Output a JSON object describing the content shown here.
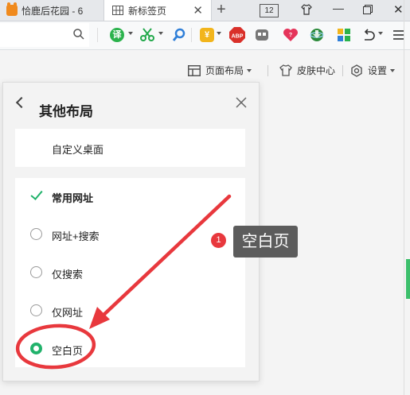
{
  "tabs": {
    "tab1_label": "恰鹿后花园 - 6",
    "tab2_label": "新标签页",
    "tab_count": "12"
  },
  "toolbar": {
    "translate_icon_text": "译",
    "abp_text": "ABP"
  },
  "subrow": {
    "layout_label": "页面布局",
    "skin_label": "皮肤中心",
    "settings_label": "设置"
  },
  "panel": {
    "title": "其他布局",
    "custom_desktop": "自定义桌面",
    "options": [
      {
        "label": "常用网址",
        "state": "checked"
      },
      {
        "label": "网址+搜索",
        "state": "off"
      },
      {
        "label": "仅搜索",
        "state": "off"
      },
      {
        "label": "仅网址",
        "state": "off"
      },
      {
        "label": "空白页",
        "state": "selected"
      }
    ]
  },
  "annotation": {
    "marker_number": "1",
    "tooltip_text": "空白页",
    "color": "#e8383d"
  },
  "colors": {
    "accent_green": "#21b26b",
    "annotation_red": "#e8383d"
  }
}
